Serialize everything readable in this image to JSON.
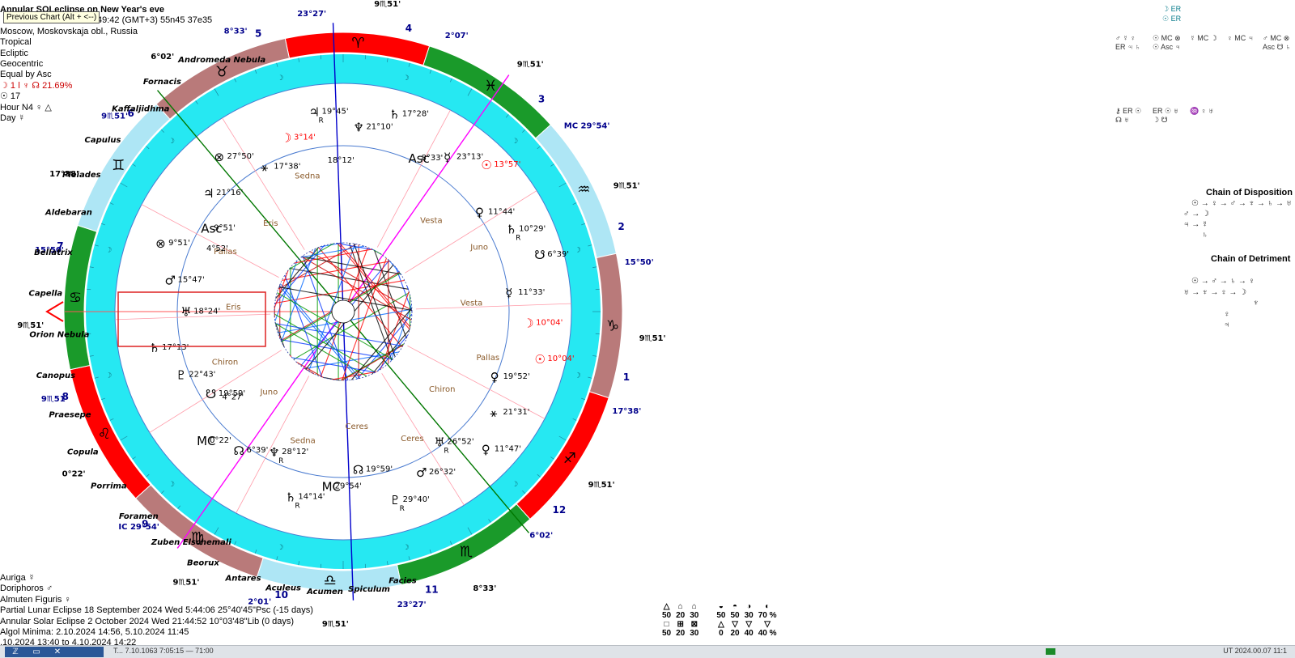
{
  "header": {
    "title": "Annular SOLeclipse on New Year's eve",
    "tooltip": "Previous Chart  (Alt + <--)",
    "time_line": "49:42 (GMT+3) 55n45  37e35",
    "location": "Moscow, Moskovskaja obl., Russia",
    "settings": [
      "Tropical",
      "Ecliptic",
      "Geocentric",
      "Equal by Asc"
    ],
    "moon_line": "☽  1 ǀ  ♆ ☊ 21.69%",
    "sun_line": "☉  17",
    "hour": "Hour N4  ♀ △",
    "day": "Day ☿"
  },
  "footer": {
    "lines": [
      "Auriga  ☿",
      "Doriphoros  ♂",
      "Almuten Figuris  ♀",
      "Partial Lunar Eclipse 18 September 2024 Wed  5:44:06 25°40'45\"Psc (-15 days)",
      "Annular Solar Eclipse 2 October 2024 Wed 21:44:52 10°03'48\"Lib (0 days)",
      "Algol Minima: 2.10.2024 14:56,  5.10.2024 11:45",
      ".10.2024 13:40 to 4.10.2024 14:22"
    ]
  },
  "right_panel": {
    "top_marks": [
      "☽ ER",
      "☉ ER"
    ],
    "dignity_cols": [
      "♂ ☿ ♀ ER ♃ ♄",
      "☉ MC ⊗ ☉ Asc ♃",
      "☿ MC ☽",
      "♀ MC ♃",
      "♂ MC ⊗ Asc ☋ ♄"
    ],
    "dignity_cols2": [
      "⚷ ER ☉ ☊ ♅",
      "ER ☉ ♅ ☽ ☋",
      "♒ ♀ ♅"
    ],
    "chain_disposition_title": "Chain of Disposition",
    "chain_disposition_rows": [
      "☉ → ♀ → ♂ → ♆ → ♄ → ♅",
      "♂ → ☽",
      "♃ → ☿",
      "♄"
    ],
    "chain_detriment_title": "Chain of Detriment",
    "chain_detriment_rows": [
      "☉ → ♂ → ♄ → ♀",
      "♅ → ♆ → ♀ → ☽",
      "♆",
      "♀",
      "♃"
    ]
  },
  "stats": {
    "row1_symbols": [
      "△",
      "⌂",
      "⌂",
      "◒",
      "◓",
      "◑",
      "◐"
    ],
    "row1_values": [
      "50",
      "20",
      "30",
      "50",
      "50",
      "30",
      "70 %"
    ],
    "row2_symbols": [
      "□",
      "⊞",
      "⊠",
      "△",
      "▽",
      "▽",
      "▽"
    ],
    "row2_values": [
      "50",
      "20",
      "30",
      "0",
      "20",
      "40",
      "40 %"
    ]
  },
  "taskbar": {
    "buttons": [
      "ℤ",
      "▭",
      "✕"
    ],
    "status": "T... 7.10.1063  7:05:15 — 71:00",
    "right": "UT  2024.00.07 11:1"
  },
  "chart": {
    "zodiac": [
      {
        "sign": "♈",
        "color": "#ff0000"
      },
      {
        "sign": "♓",
        "color": "#1a9a2a"
      },
      {
        "sign": "♒",
        "color": "#aee6f5"
      },
      {
        "sign": "♑",
        "color": "#b97a7a"
      },
      {
        "sign": "♐",
        "color": "#ff0000"
      },
      {
        "sign": "♏",
        "color": "#1a9a2a"
      },
      {
        "sign": "♎",
        "color": "#aee6f5"
      },
      {
        "sign": "♍",
        "color": "#b97a7a"
      },
      {
        "sign": "♌",
        "color": "#ff0000"
      },
      {
        "sign": "♋",
        "color": "#1a9a2a"
      },
      {
        "sign": "♊",
        "color": "#aee6f5"
      },
      {
        "sign": "♉",
        "color": "#b97a7a"
      }
    ],
    "house_numbers": [
      "5",
      "4",
      "3",
      "2",
      "1",
      "12",
      "11",
      "10",
      "9",
      "8",
      "7",
      "6"
    ],
    "outer_labels": [
      "23°27'",
      "9♏51'",
      "2°07'",
      "9♏51'",
      "MC 29°54'",
      "9♏51'",
      "15°50'",
      "9♏51'",
      "17°38'",
      "9♏51'",
      "6°02'",
      "8°33'",
      "23°27'",
      "9♏51'",
      "2°01'",
      "9♏51'",
      "IC 29°54'",
      "0°22'",
      "9♏51'",
      "9♏51'",
      "15°50'",
      "17°38'",
      "9♏51'",
      "6°02'",
      "8°33'"
    ],
    "stars": [
      "Andromeda Nebula",
      "Fornacis",
      "Kaffaljidhma",
      "Capulus",
      "Pleiades",
      "Aldebaran",
      "Bellatrix",
      "Capella",
      "Orion Nebula",
      "Canopus",
      "Praesepe",
      "Copula",
      "Porrima",
      "Foramen",
      "Zuben Elschemali",
      "Beorux",
      "Antares",
      "Aculeus",
      "Acumen",
      "Spiculum",
      "Facies"
    ],
    "planets": [
      {
        "glyph": "♃",
        "deg": "19°45'",
        "r": "R"
      },
      {
        "glyph": "☽",
        "deg": "3°14'"
      },
      {
        "glyph": "⚹",
        "deg": "17°38'"
      },
      {
        "glyph": "⊗",
        "deg": "27°50'"
      },
      {
        "glyph": "♃",
        "deg": "21°16'"
      },
      {
        "glyph": "Asc",
        "deg": "9°51'"
      },
      {
        "glyph": "⊗",
        "deg": "9°51'"
      },
      {
        "glyph": "♂",
        "deg": "15°47'"
      },
      {
        "glyph": "♅",
        "deg": "18°24'"
      },
      {
        "glyph": "♄",
        "deg": "17°13'"
      },
      {
        "glyph": "♇",
        "deg": "22°43'"
      },
      {
        "glyph": "☋",
        "deg": "19°59'"
      },
      {
        "glyph": "MC",
        "deg": "0°22'"
      },
      {
        "glyph": "☊",
        "deg": "6°39'"
      },
      {
        "glyph": "♆",
        "deg": "28°12'",
        "r": "R"
      },
      {
        "glyph": "♄",
        "deg": "14°14'",
        "r": "R"
      },
      {
        "glyph": "MC",
        "deg": "29°54'"
      },
      {
        "glyph": "☊",
        "deg": "19°59'"
      },
      {
        "glyph": "♇",
        "deg": "29°40'",
        "r": "R"
      },
      {
        "glyph": "♂",
        "deg": "26°32'"
      },
      {
        "glyph": "♅",
        "deg": "26°52'",
        "r": "R"
      },
      {
        "glyph": "♀",
        "deg": "11°47'"
      },
      {
        "glyph": "⚹",
        "deg": "21°31'"
      },
      {
        "glyph": "♀",
        "deg": "19°52'"
      },
      {
        "glyph": "☉",
        "deg": "10°04'"
      },
      {
        "glyph": "☽",
        "deg": "10°04'"
      },
      {
        "glyph": "☿",
        "deg": "11°33'"
      },
      {
        "glyph": "☋",
        "deg": "6°39'"
      },
      {
        "glyph": "♄",
        "deg": "10°29'",
        "r": "R"
      },
      {
        "glyph": "♀",
        "deg": "11°44'"
      },
      {
        "glyph": "☉",
        "deg": "13°57'"
      },
      {
        "glyph": "☿",
        "deg": "23°13'"
      },
      {
        "glyph": "Asc",
        "deg": "8°33'"
      },
      {
        "glyph": "♄",
        "deg": "17°28'"
      },
      {
        "glyph": "♆",
        "deg": "21°10'"
      }
    ],
    "inner_names": [
      "Sedna",
      "Eris",
      "Pallas",
      "Eris",
      "Chiron",
      "Juno",
      "Sedna",
      "Ceres",
      "Ceres",
      "Chiron",
      "Pallas",
      "Vesta",
      "Juno",
      "Vesta"
    ],
    "inner_degrees": [
      "18°12'",
      "4°52'",
      "4°27'"
    ]
  }
}
